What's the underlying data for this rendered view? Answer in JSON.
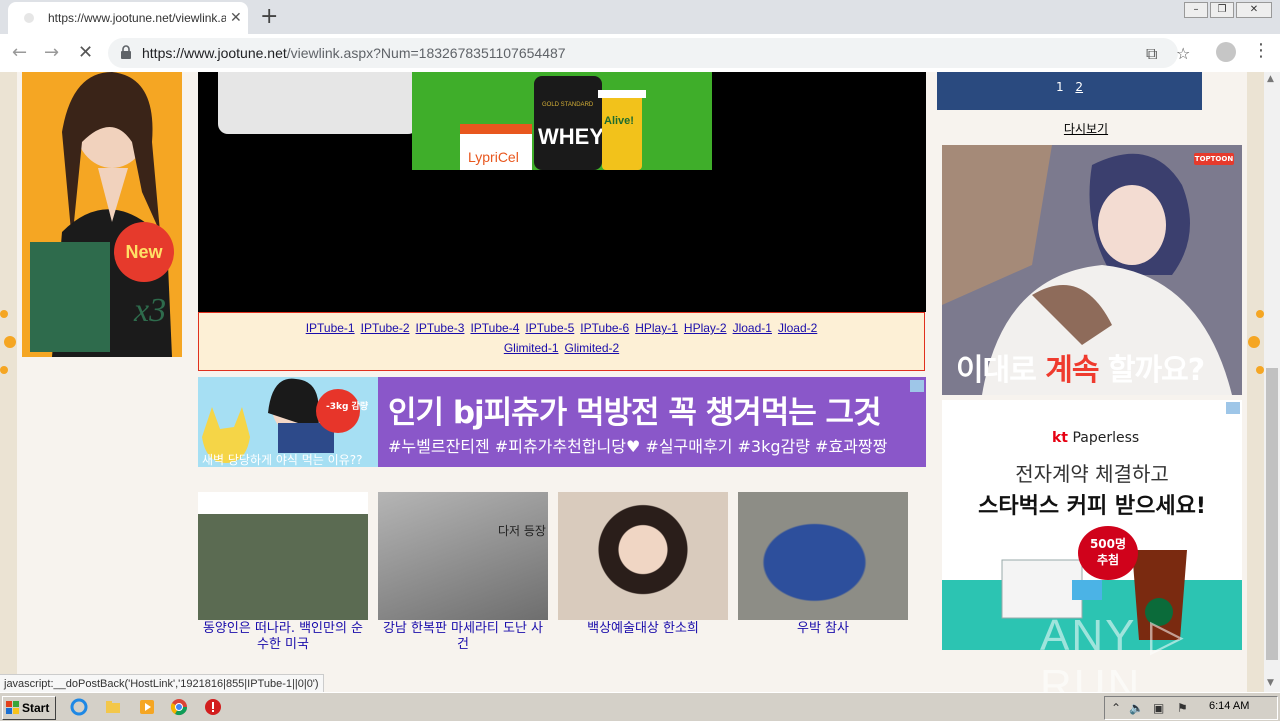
{
  "browser": {
    "tab_title": "https://www.jootune.net/viewlink.a",
    "url_host": "https://www.jootune.net",
    "url_path": "/viewlink.aspx?Num=1832678351107654487",
    "status_text": "javascript:__doPostBack('HostLink','1921816|855|IPTube-1||0|0')"
  },
  "pager": {
    "p1": "1",
    "p2": "2"
  },
  "reload_label": "다시보기",
  "left_ad": {
    "badge": "New",
    "mark": "x3"
  },
  "whey_ad": {
    "brand": "WHEY",
    "label1": "GOLD STANDARD",
    "label2": "LypriCel",
    "label3": "Alive!"
  },
  "host_links": {
    "row1": [
      "IPTube-1",
      "IPTube-2",
      "IPTube-3",
      "IPTube-4",
      "IPTube-5",
      "IPTube-6",
      "HPlay-1",
      "HPlay-2",
      "Jload-1",
      "Jload-2"
    ],
    "row2": [
      "Glimited-1",
      "Glimited-2"
    ]
  },
  "banner": {
    "title": "인기 bj피츄가 먹방전 꼭 챙겨먹는 그것",
    "tags": "#누벨르잔티젠 #피츄가추천합니당♥ #실구매후기 #3kg감량 #효과짱짱",
    "sub": "새벽 당당하게 야식 먹는 이유??",
    "sticker": "-3kg 감량"
  },
  "thumbnails": [
    {
      "caption": "동양인은 떠나라. 백인만의 순수한 미국",
      "color": "#5b6b52"
    },
    {
      "caption": "강남 한복판 마세라티 도난 사건",
      "color": "#8a8a8a"
    },
    {
      "caption": "백상예술대상 한소희",
      "color": "#c8b8a8"
    },
    {
      "caption": "우박 참사",
      "color": "#4a5e8a"
    }
  ],
  "thumb_overlay": "다저 등장",
  "manhwa_ad": {
    "text_white1": "이대로 ",
    "text_red": "계속",
    "text_white2": " 할까요?",
    "badge": "TOPTOON"
  },
  "kt_ad": {
    "logo_kt": "kt",
    "logo_rest": " Paperless",
    "line1": "전자계약 체결하고",
    "line2": "스타벅스 커피 받으세요!",
    "badge1": "500명",
    "badge2": "추첨"
  },
  "watermark": "ANY ▷ RUN",
  "taskbar": {
    "start": "Start",
    "clock": "6:14 AM"
  },
  "colors": {
    "accent_red": "#e0301e",
    "link": "#1a0dab",
    "pager_bg": "#2a4a7f"
  }
}
